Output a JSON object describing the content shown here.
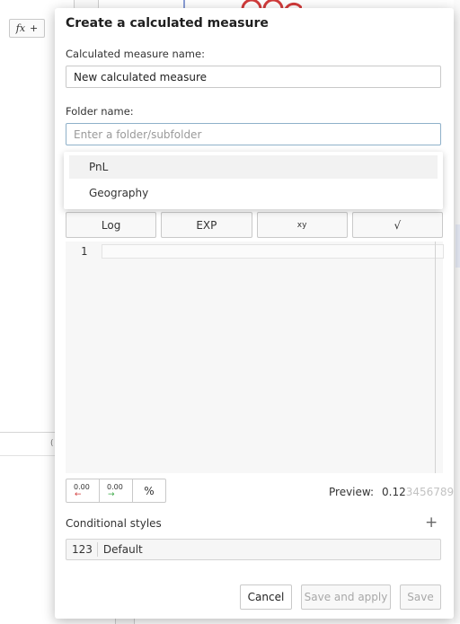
{
  "background": {
    "fx_button": {
      "fx": "fx",
      "plus": "+"
    },
    "paren": "(",
    "colors": {
      "accent_line": "#8b9ed6",
      "red_marks": "#d23b3b"
    }
  },
  "dialog": {
    "title": "Create a calculated measure",
    "name_label": "Calculated measure name:",
    "name_value": "New calculated measure",
    "folder_label": "Folder name:",
    "folder_placeholder": "Enter a folder/subfolder",
    "folder_options": [
      "PnL",
      "Geography"
    ],
    "function_buttons": {
      "log": "Log",
      "exp": "EXP",
      "power_base": "x",
      "power_exp": "y",
      "sqrt": "√"
    },
    "editor": {
      "line_number": "1"
    },
    "format_buttons": {
      "decrease_decimals": "0.00",
      "increase_decimals": "0.00",
      "percent": "%"
    },
    "preview": {
      "label": "Preview:",
      "value_shown": "0.12",
      "value_faint": "3456789"
    },
    "conditional_styles": {
      "title": "Conditional styles",
      "add": "+",
      "items": [
        {
          "chip": "123",
          "name": "Default"
        }
      ]
    },
    "footer": {
      "cancel": "Cancel",
      "save_and_apply": "Save and apply",
      "save": "Save"
    }
  }
}
